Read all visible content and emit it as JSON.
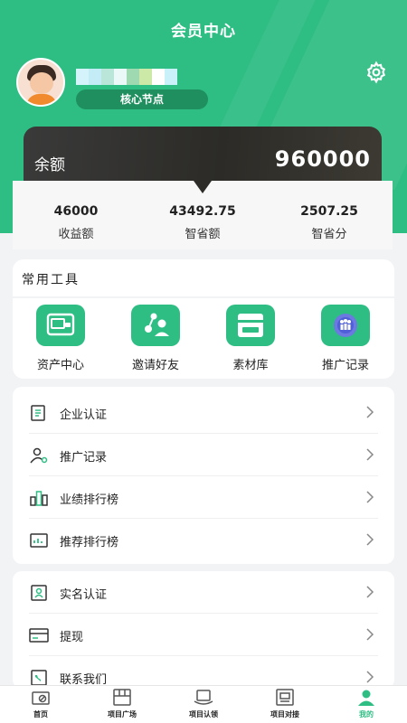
{
  "header": {
    "title": "会员中心",
    "level_badge": "核心节点",
    "username_tiles": [
      "#d4f3fb",
      "#c4ecf6",
      "#b9e6d9",
      "#eaf8f8",
      "#9fd9b2",
      "#cde9a8",
      "#ffffff",
      "#c8f1fa"
    ]
  },
  "balance": {
    "label": "余额",
    "value": "960000"
  },
  "stats": [
    {
      "value": "46000",
      "label": "收益额"
    },
    {
      "value": "43492.75",
      "label": "智省额"
    },
    {
      "value": "2507.25",
      "label": "智省分"
    }
  ],
  "tools": {
    "title": "常用工具",
    "items": [
      {
        "label": "资产中心",
        "icon": "wallet-icon"
      },
      {
        "label": "邀请好友",
        "icon": "invite-friends-icon"
      },
      {
        "label": "素材库",
        "icon": "store-icon"
      },
      {
        "label": "推广记录",
        "icon": "people-icon"
      }
    ]
  },
  "menu1": [
    {
      "label": "企业认证",
      "icon": "certificate-icon"
    },
    {
      "label": "推广记录",
      "icon": "share-user-icon"
    },
    {
      "label": "业绩排行榜",
      "icon": "bar-ranking-icon"
    },
    {
      "label": "推荐排行榜",
      "icon": "chart-ranking-icon"
    }
  ],
  "menu2": [
    {
      "label": "实名认证",
      "icon": "id-card-icon"
    },
    {
      "label": "提现",
      "icon": "card-icon"
    },
    {
      "label": "联系我们",
      "icon": "contact-icon"
    }
  ],
  "tabbar": [
    {
      "label": "首页",
      "icon": "home-icon",
      "active": false
    },
    {
      "label": "项目广场",
      "icon": "square-icon",
      "active": false
    },
    {
      "label": "项目认领",
      "icon": "claim-icon",
      "active": false
    },
    {
      "label": "项目对接",
      "icon": "docking-icon",
      "active": false
    },
    {
      "label": "我的",
      "icon": "user-icon",
      "active": true
    }
  ],
  "colors": {
    "brand_green": "#2ebd83",
    "dark_green": "#1f8f5f",
    "card_dark": "#2c2b27"
  }
}
